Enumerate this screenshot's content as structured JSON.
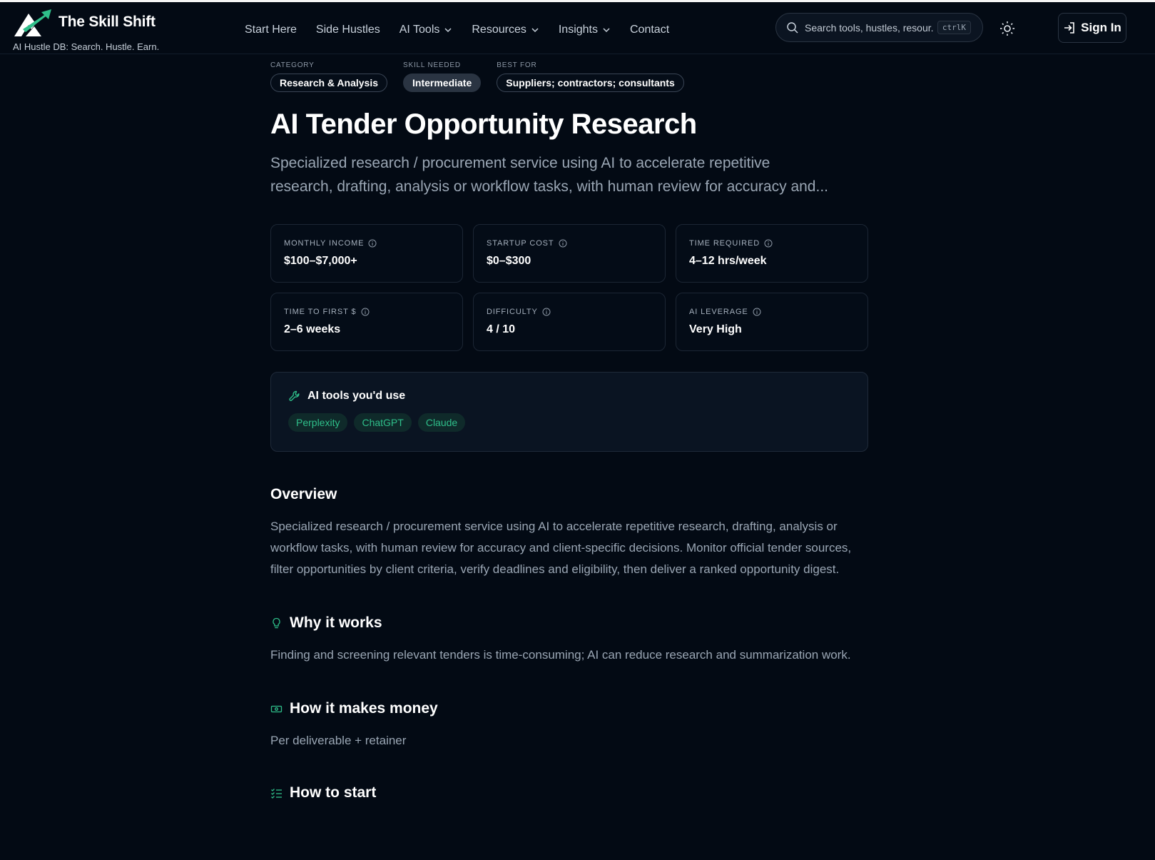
{
  "brand": {
    "name": "The Skill Shift",
    "tagline": "AI Hustle DB: Search. Hustle. Earn."
  },
  "nav": [
    {
      "label": "Start Here",
      "dropdown": false
    },
    {
      "label": "Side Hustles",
      "dropdown": false
    },
    {
      "label": "AI Tools",
      "dropdown": true
    },
    {
      "label": "Resources",
      "dropdown": true
    },
    {
      "label": "Insights",
      "dropdown": true
    },
    {
      "label": "Contact",
      "dropdown": false
    }
  ],
  "search": {
    "placeholder": "Search tools, hustles, resour...",
    "shortcut": "ctrlK"
  },
  "signin": {
    "label": "Sign In"
  },
  "meta": {
    "category": {
      "label": "CATEGORY",
      "value": "Research & Analysis"
    },
    "skill": {
      "label": "SKILL NEEDED",
      "value": "Intermediate"
    },
    "best_for": {
      "label": "BEST FOR",
      "value": "Suppliers; contractors; consultants"
    }
  },
  "title": "AI Tender Opportunity Research",
  "subtitle": "Specialized research / procurement service using AI to accelerate repetitive research, drafting, analysis or workflow tasks, with human review for accuracy and...",
  "stats": [
    {
      "label": "MONTHLY INCOME",
      "value": "$100–$7,000+"
    },
    {
      "label": "STARTUP COST",
      "value": "$0–$300"
    },
    {
      "label": "TIME REQUIRED",
      "value": "4–12 hrs/week"
    },
    {
      "label": "TIME TO FIRST $",
      "value": "2–6 weeks"
    },
    {
      "label": "DIFFICULTY",
      "value": "4 / 10"
    },
    {
      "label": "AI LEVERAGE",
      "value": "Very High"
    }
  ],
  "tools": {
    "heading": "AI tools you'd use",
    "items": [
      "Perplexity",
      "ChatGPT",
      "Claude"
    ]
  },
  "overview": {
    "heading": "Overview",
    "text": "Specialized research / procurement service using AI to accelerate repetitive research, drafting, analysis or workflow tasks, with human review for accuracy and client-specific decisions. Monitor official tender sources, filter opportunities by client criteria, verify deadlines and eligibility, then deliver a ranked opportunity digest."
  },
  "why": {
    "heading": "Why it works",
    "text": "Finding and screening relevant tenders is time-consuming; AI can reduce research and summarization work."
  },
  "money": {
    "heading": "How it makes money",
    "text": "Per deliverable + retainer"
  },
  "start": {
    "heading": "How to start"
  },
  "colors": {
    "background": "#030a14",
    "accent": "#2fbf8a",
    "text_muted": "#9aa6b4"
  }
}
